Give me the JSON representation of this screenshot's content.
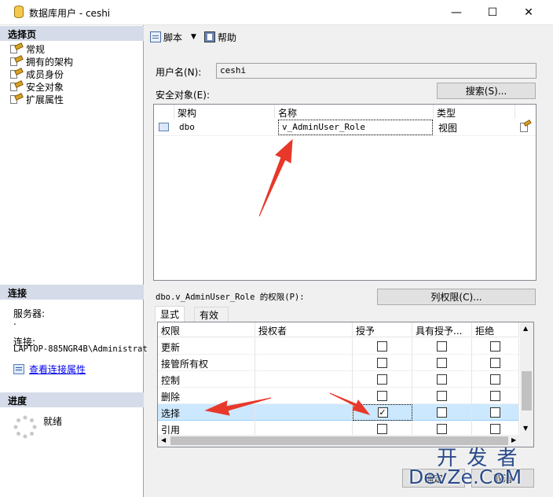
{
  "window": {
    "title": "数据库用户 - ceshi",
    "controls": {
      "minimize": "—",
      "maximize": "☐",
      "close": "✕"
    }
  },
  "left": {
    "select_page_header": "选择页",
    "nav_items": [
      "常规",
      "拥有的架构",
      "成员身份",
      "安全对象",
      "扩展属性"
    ],
    "connection_header": "连接",
    "server_label": "服务器:",
    "server_value": ".",
    "connection_label": "连接:",
    "connection_value": "LAPTOP-885NGR4B\\Administrat",
    "view_connection_link": "查看连接属性",
    "progress_header": "进度",
    "progress_status": "就绪"
  },
  "toolbar": {
    "script_label": "脚本",
    "help_label": "帮助"
  },
  "form": {
    "username_label": "用户名(N):",
    "username_value": "ceshi",
    "securables_label": "安全对象(E):",
    "search_button": "搜索(S)...",
    "securables_columns": [
      "架构",
      "名称",
      "类型"
    ],
    "securables_rows": [
      {
        "schema": "dbo",
        "name": "v_AdminUser_Role",
        "type": "视图"
      }
    ],
    "permissions_label": "dbo.v_AdminUser_Role 的权限(P):",
    "column_permissions_button": "列权限(C)...",
    "tabs": [
      "显式",
      "有效"
    ],
    "perm_columns": [
      "权限",
      "授权者",
      "授予",
      "具有授予...",
      "拒绝"
    ],
    "perm_rows": [
      {
        "name": "更新",
        "grantor": "",
        "grant": false,
        "with_grant": false,
        "deny": false
      },
      {
        "name": "接管所有权",
        "grantor": "",
        "grant": false,
        "with_grant": false,
        "deny": false
      },
      {
        "name": "控制",
        "grantor": "",
        "grant": false,
        "with_grant": false,
        "deny": false
      },
      {
        "name": "删除",
        "grantor": "",
        "grant": false,
        "with_grant": false,
        "deny": false
      },
      {
        "name": "选择",
        "grantor": "",
        "grant": true,
        "with_grant": false,
        "deny": false
      },
      {
        "name": "引用",
        "grantor": "",
        "grant": false,
        "with_grant": false,
        "deny": false
      }
    ],
    "ok_button": "确定",
    "cancel_button": "取消"
  },
  "watermark": {
    "line1": "开 发 者",
    "line2": "DevZe.CoM"
  },
  "colors": {
    "selected_row": "#cce8ff",
    "arrow": "#e8382a",
    "section_header": "#d6dbe9"
  }
}
